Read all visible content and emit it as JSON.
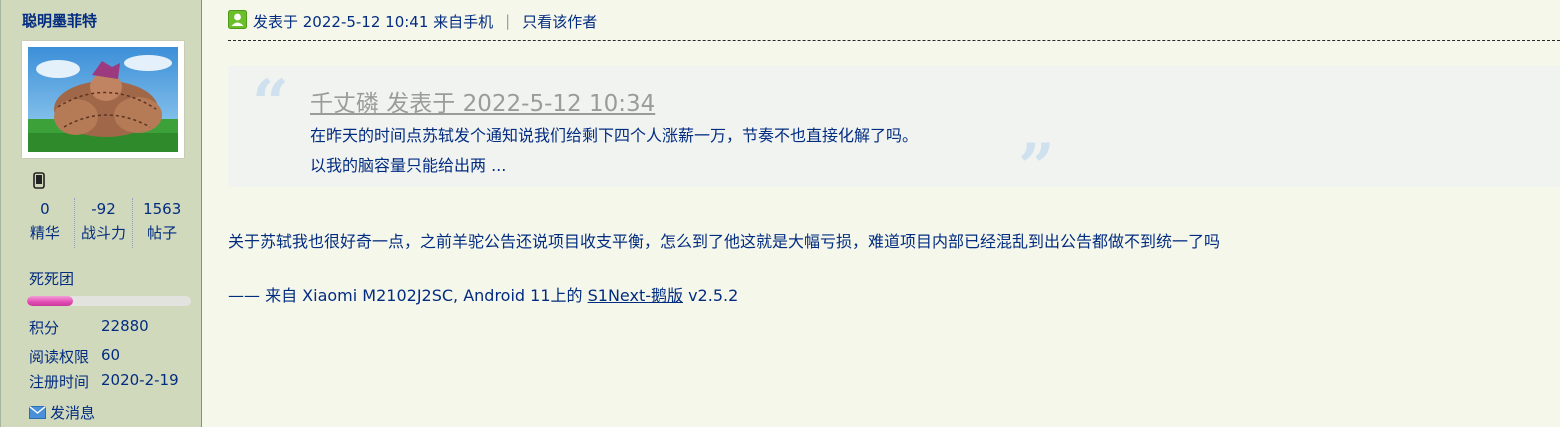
{
  "author": {
    "name": "聪明墨菲特",
    "device_icon": "mobile-phone-icon",
    "stats": [
      {
        "value": "0",
        "label": "精华"
      },
      {
        "value": "-92",
        "label": "战斗力"
      },
      {
        "value": "1563",
        "label": "帖子"
      }
    ],
    "group": "死死团",
    "group_progress": 0.28,
    "info": [
      {
        "key": "积分",
        "value": "22880"
      },
      {
        "key": "阅读权限",
        "value": "60"
      },
      {
        "key": "注册时间",
        "value": "2020-2-19"
      }
    ],
    "send_message": "发消息"
  },
  "post": {
    "posted_at": "发表于 2022-5-12 10:41 来自手机",
    "separator": "|",
    "only_author": "只看该作者",
    "quote": {
      "header": "千丈磷 发表于 2022-5-12 10:34",
      "lines": [
        "在昨天的时间点苏轼发个通知说我们给剩下四个人涨薪一万，节奏不也直接化解了吗。",
        "以我的脑容量只能给出两 ..."
      ]
    },
    "body": "关于苏轼我也很好奇一点，之前羊驼公告还说项目收支平衡，怎么到了他这就是大幅亏损，难道项目内部已经混乱到出公告都做不到统一了吗",
    "signature": {
      "prefix": "—— 来自 Xiaomi M2102J2SC, Android 11上的 ",
      "app_link": "S1Next-鹅版",
      "version": " v2.5.2"
    }
  },
  "colors": {
    "page_bg": "#f6f7eb",
    "sidebar_bg": "#d1d9bd",
    "text": "#022c80",
    "quote_bg": "#f1f3f1",
    "quote_header": "#9b9b9b",
    "progress": "#e24ab4"
  }
}
